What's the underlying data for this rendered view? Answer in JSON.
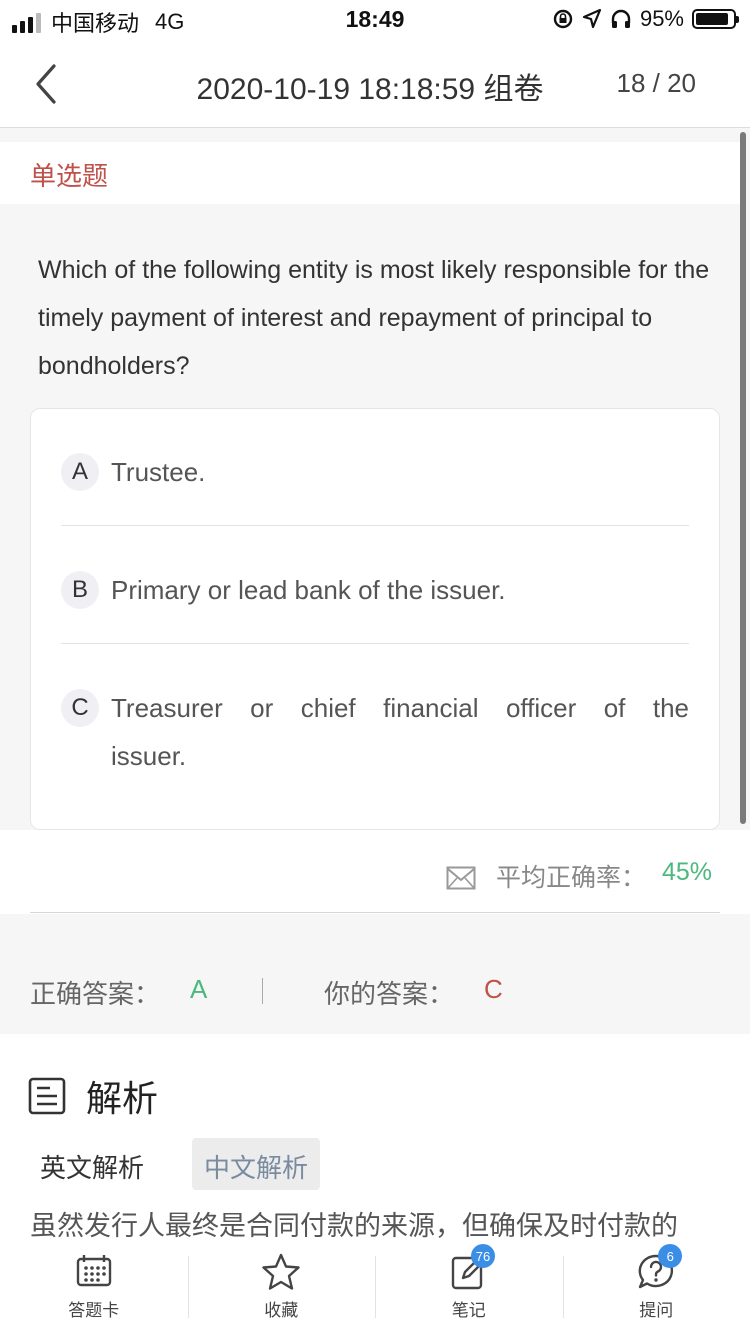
{
  "status_bar": {
    "carrier": "中国移动",
    "network": "4G",
    "time": "18:49",
    "battery": "95%"
  },
  "nav": {
    "title": "2020-10-19 18:18:59 组卷",
    "counter": "18 / 20"
  },
  "question": {
    "type_label": "单选题",
    "text": "Which of the following entity is most likely responsible for the timely payment of interest and repayment of principal to bondholders?",
    "options": [
      {
        "letter": "A",
        "text": "Trustee."
      },
      {
        "letter": "B",
        "text": "Primary or lead bank of the issuer."
      },
      {
        "letter": "C",
        "text": "Treasurer or chief financial officer of the issuer."
      }
    ]
  },
  "stats": {
    "avg_label": "平均正确率：",
    "avg_value": "45%"
  },
  "answers": {
    "correct_label": "正确答案：",
    "correct_value": "A",
    "yours_label": "你的答案：",
    "yours_value": "C"
  },
  "analysis": {
    "title": "解析",
    "tabs": [
      "英文解析",
      "中文解析"
    ],
    "active_tab": 1,
    "text": "虽然发行人最终是合同付款的来源，但确保及时付款的"
  },
  "tab_bar": {
    "items": [
      {
        "label": "答题卡",
        "icon": "answer-card-icon"
      },
      {
        "label": "收藏",
        "icon": "star-icon"
      },
      {
        "label": "笔记",
        "icon": "note-edit-icon",
        "badge": "76"
      },
      {
        "label": "提问",
        "icon": "question-bubble-icon",
        "badge": "6"
      }
    ]
  },
  "colors": {
    "accent_red": "#c0504a",
    "accent_green": "#4cb87e",
    "badge_blue": "#3a8ee6"
  }
}
